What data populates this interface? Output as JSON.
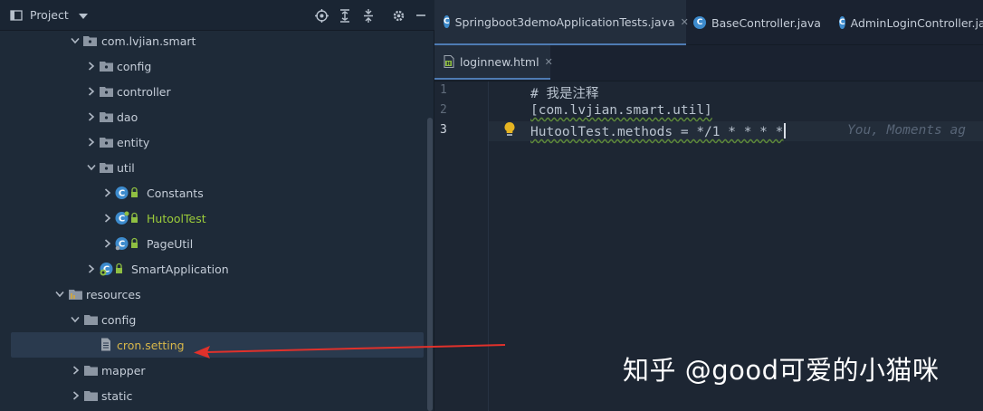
{
  "project_panel": {
    "title": "Project",
    "tree": [
      {
        "label": "com.lvjian.smart",
        "icon": "package-folder-icon",
        "expanded": true
      },
      {
        "label": "config",
        "icon": "package-folder-icon",
        "expanded": false
      },
      {
        "label": "controller",
        "icon": "package-folder-icon",
        "expanded": false
      },
      {
        "label": "dao",
        "icon": "package-folder-icon",
        "expanded": false
      },
      {
        "label": "entity",
        "icon": "package-folder-icon",
        "expanded": false
      },
      {
        "label": "util",
        "icon": "package-folder-icon",
        "expanded": true
      },
      {
        "label": "Constants",
        "icon": "java-class-icon",
        "expanded": false
      },
      {
        "label": "HutoolTest",
        "icon": "java-class-icon",
        "expanded": false
      },
      {
        "label": "PageUtil",
        "icon": "java-class-icon",
        "expanded": false
      },
      {
        "label": "SmartApplication",
        "icon": "spring-boot-class-icon",
        "expanded": false
      },
      {
        "label": "resources",
        "icon": "resources-folder-icon",
        "expanded": true
      },
      {
        "label": "config",
        "icon": "folder-icon",
        "expanded": true
      },
      {
        "label": "cron.setting",
        "icon": "file-icon",
        "selected": true
      },
      {
        "label": "mapper",
        "icon": "folder-icon",
        "expanded": false
      },
      {
        "label": "static",
        "icon": "folder-icon",
        "expanded": false
      }
    ]
  },
  "editor": {
    "tabs": [
      {
        "label": "Springboot3demoApplicationTests.java",
        "icon": "java-class-icon",
        "active": true,
        "closable": true
      },
      {
        "label": "BaseController.java",
        "icon": "java-class-icon",
        "active": false
      },
      {
        "label": "AdminLoginController.java",
        "icon": "java-class-icon",
        "active": false
      }
    ],
    "second_row_tab": {
      "label": "loginnew.html",
      "icon": "html-file-icon"
    },
    "lines": [
      {
        "number": "1",
        "text": "# 我是注释"
      },
      {
        "number": "2",
        "text": "[com.lvjian.smart.util]"
      },
      {
        "number": "3",
        "text": "HutoolTest.methods = */1 * * * *"
      }
    ],
    "blame_text": "You, Moments ag"
  },
  "watermark": "知乎 @good可爱的小猫咪",
  "colors": {
    "accent_green": "#9ccc3a",
    "arrow_red": "#e0312b",
    "selection": "#2a3a4e"
  }
}
